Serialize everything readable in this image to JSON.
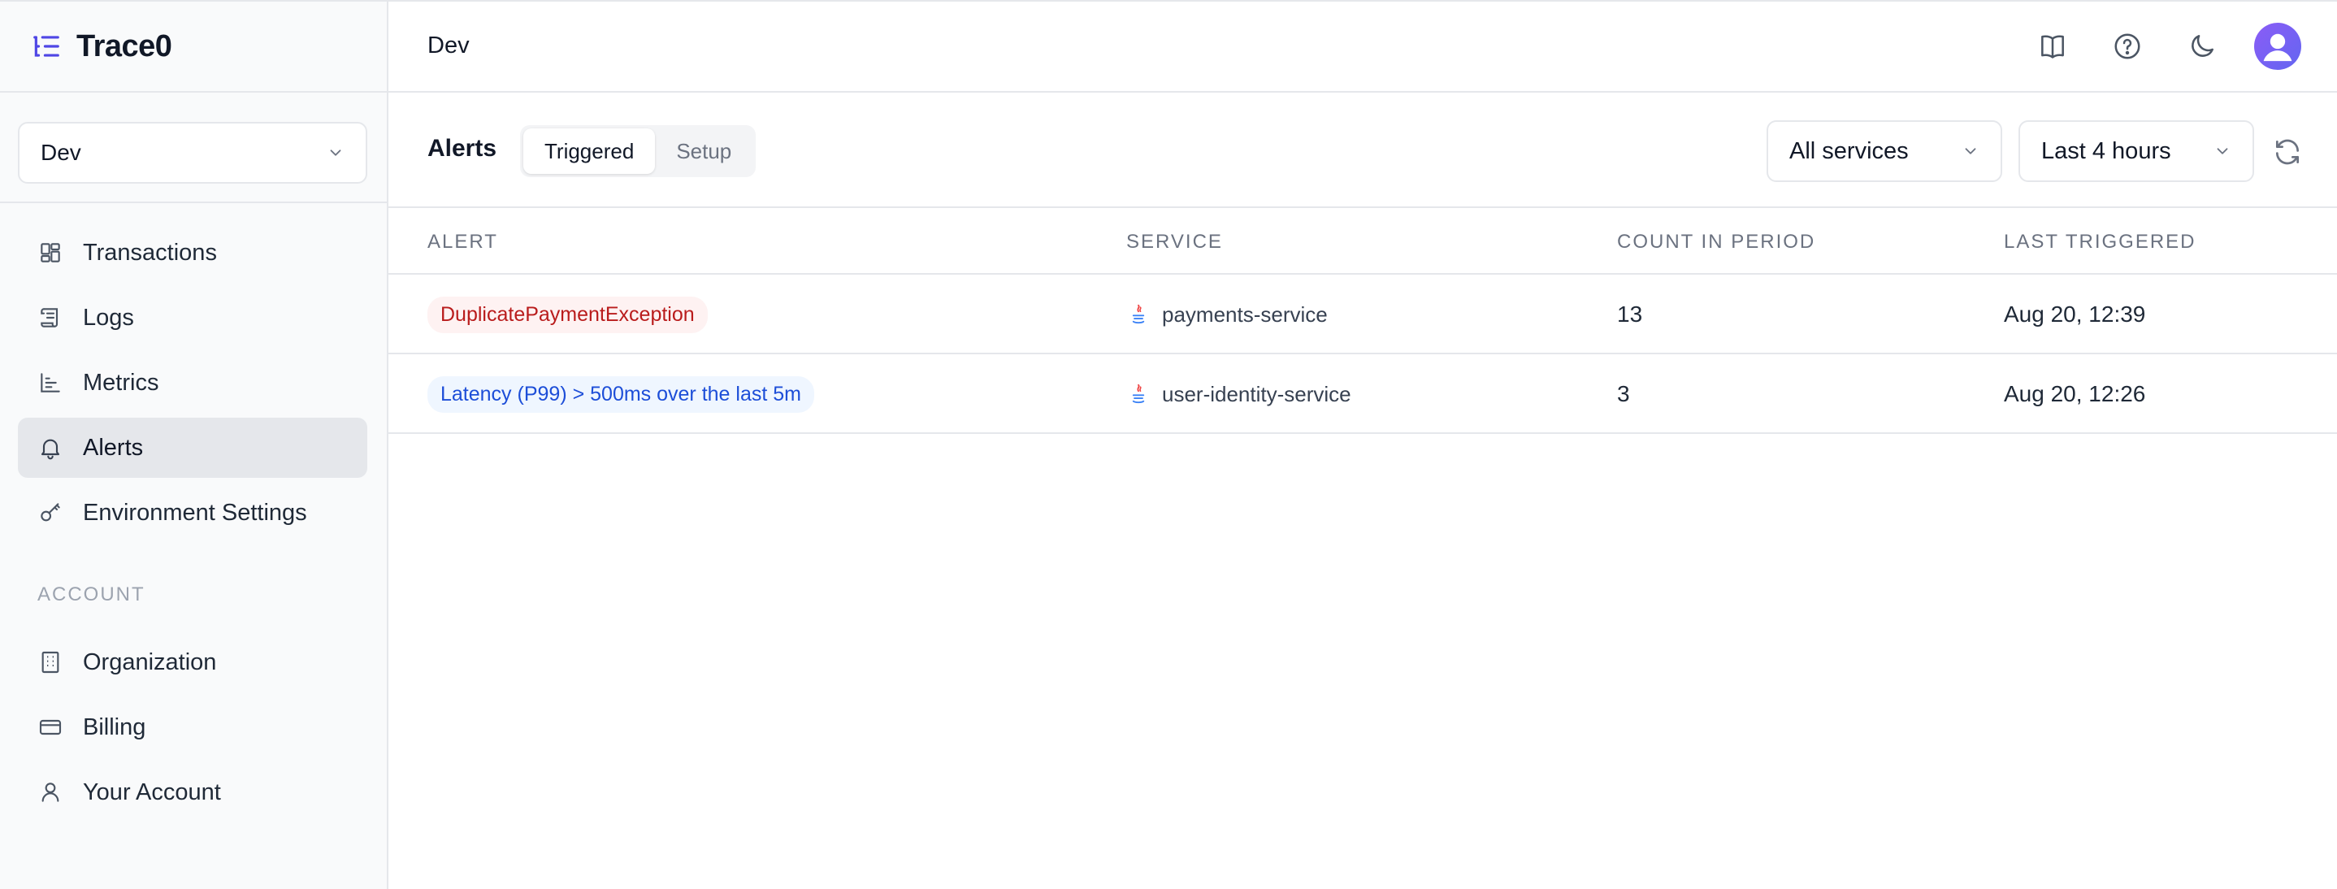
{
  "brand": {
    "name": "Trace0"
  },
  "environment": {
    "selected": "Dev"
  },
  "nav": {
    "items": [
      {
        "label": "Transactions",
        "icon": "transactions-icon"
      },
      {
        "label": "Logs",
        "icon": "logs-icon"
      },
      {
        "label": "Metrics",
        "icon": "metrics-icon"
      },
      {
        "label": "Alerts",
        "icon": "bell-icon",
        "active": true
      },
      {
        "label": "Environment Settings",
        "icon": "key-icon"
      }
    ],
    "account_label": "ACCOUNT",
    "account_items": [
      {
        "label": "Organization",
        "icon": "building-icon"
      },
      {
        "label": "Billing",
        "icon": "credit-card-icon"
      },
      {
        "label": "Your Account",
        "icon": "user-icon"
      }
    ]
  },
  "header": {
    "title": "Dev"
  },
  "toolbar": {
    "title": "Alerts",
    "tabs": [
      "Triggered",
      "Setup"
    ],
    "active_tab": "Triggered",
    "services_filter": "All services",
    "time_range": "Last 4 hours"
  },
  "table": {
    "columns": [
      "ALERT",
      "SERVICE",
      "COUNT IN PERIOD",
      "LAST TRIGGERED"
    ],
    "rows": [
      {
        "alert": "DuplicatePaymentException",
        "alert_style": "error",
        "service": "payments-service",
        "count": "13",
        "last_triggered": "Aug 20, 12:39"
      },
      {
        "alert": "Latency (P99) > 500ms over the last 5m",
        "alert_style": "metric",
        "service": "user-identity-service",
        "count": "3",
        "last_triggered": "Aug 20, 12:26"
      }
    ]
  },
  "colors": {
    "accent": "#6366f1",
    "error_text": "#b91c1c",
    "error_bg": "#fef2f2",
    "metric_text": "#1d4ed8",
    "metric_bg": "#eff6ff"
  }
}
